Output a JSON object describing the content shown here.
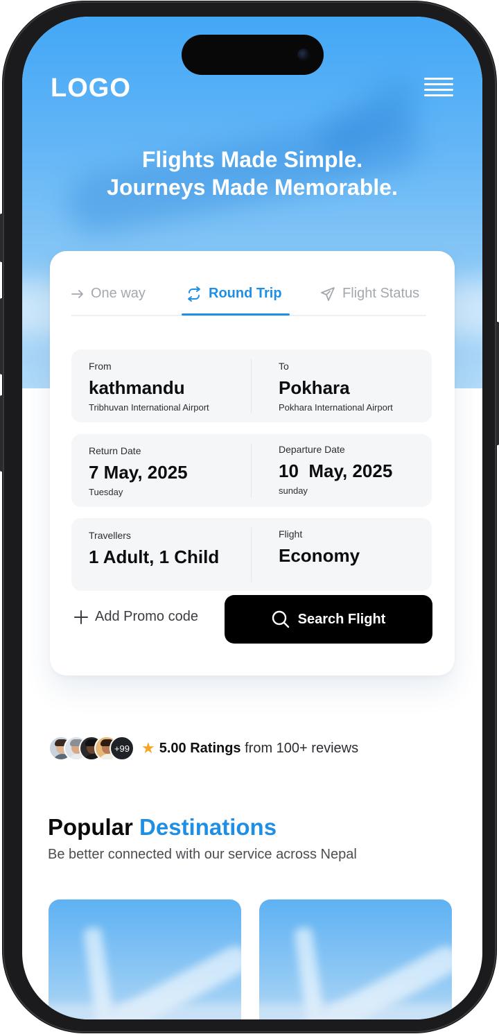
{
  "header": {
    "logo": "LOGO",
    "hero_line1": "Flights Made Simple.",
    "hero_line2": "Journeys Made Memorable."
  },
  "tabs": [
    {
      "label": "One way",
      "icon": "arrow-right-icon",
      "active": false
    },
    {
      "label": "Round Trip",
      "icon": "repeat-icon",
      "active": true
    },
    {
      "label": "Flight Status",
      "icon": "send-icon",
      "active": false
    }
  ],
  "route": {
    "from_label": "From",
    "from_city": "kathmandu",
    "from_airport": "Tribhuvan International Airport",
    "to_label": "To",
    "to_city": "Pokhara",
    "to_airport": "Pokhara International Airport"
  },
  "dates": {
    "return_label": "Return Date",
    "return_date": "7 May, 2025",
    "return_day": "Tuesday",
    "departure_label": "Departure Date",
    "departure_date": "10  May, 2025",
    "departure_day": "sunday"
  },
  "passengers": {
    "travellers_label": "Travellers",
    "travellers_value": "1 Adult, 1 Child",
    "class_label": "Flight",
    "class_value": "Economy"
  },
  "actions": {
    "promo_label": "Add Promo code",
    "search_label": "Search Flight"
  },
  "ratings": {
    "more_count": "+99",
    "score": "5.00 Ratings",
    "suffix": "from 100+ reviews"
  },
  "destinations": {
    "title_plain": "Popular",
    "title_accent": "Destinations",
    "subtitle": "Be better connected with our service across Nepal"
  },
  "colors": {
    "accent": "#1f8fe6",
    "hero_top": "#43a7f6",
    "button": "#000000",
    "star": "#f5a623"
  }
}
